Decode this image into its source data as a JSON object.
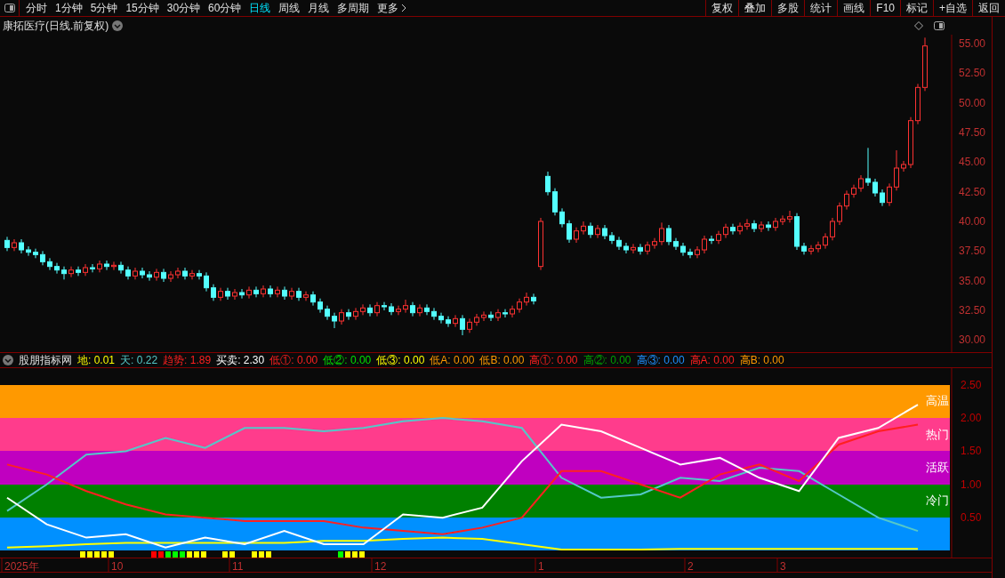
{
  "toolbar": {
    "periods": [
      {
        "label": "分时",
        "selected": false
      },
      {
        "label": "1分钟",
        "selected": false
      },
      {
        "label": "5分钟",
        "selected": false
      },
      {
        "label": "15分钟",
        "selected": false
      },
      {
        "label": "30分钟",
        "selected": false
      },
      {
        "label": "60分钟",
        "selected": false
      },
      {
        "label": "日线",
        "selected": true
      },
      {
        "label": "周线",
        "selected": false
      },
      {
        "label": "月线",
        "selected": false
      },
      {
        "label": "多周期",
        "selected": false
      },
      {
        "label": "更多",
        "selected": false,
        "kind": "menu"
      }
    ],
    "buttons": [
      "复权",
      "叠加",
      "多股",
      "统计",
      "画线",
      "F10",
      "标记",
      "+自选",
      "返回"
    ]
  },
  "price_chart": {
    "title": "康拓医疗(日线.前复权)",
    "chart_data": {
      "type": "candlestick",
      "ylim": [
        28.9,
        55.75
      ],
      "yticks": [
        {
          "value": 55,
          "label": "55.00"
        },
        {
          "value": 52.5,
          "label": "52.50"
        },
        {
          "value": 50,
          "label": "50.00"
        },
        {
          "value": 47.5,
          "label": "47.50"
        },
        {
          "value": 45,
          "label": "45.00"
        },
        {
          "value": 42.5,
          "label": "42.50"
        },
        {
          "value": 40,
          "label": "40.00"
        },
        {
          "value": 37.5,
          "label": "37.50"
        },
        {
          "value": 35,
          "label": "35.00"
        },
        {
          "value": 32.5,
          "label": "32.50"
        },
        {
          "value": 30,
          "label": "30.00"
        }
      ],
      "ohlc": [
        [
          38.4,
          38.7,
          37.5,
          37.8
        ],
        [
          37.8,
          38.5,
          37.5,
          38.2
        ],
        [
          38.2,
          38.5,
          37.3,
          37.6
        ],
        [
          37.6,
          37.9,
          37.1,
          37.4
        ],
        [
          37.4,
          37.7,
          36.9,
          37.2
        ],
        [
          37.2,
          37.5,
          36.3,
          36.6
        ],
        [
          36.6,
          36.9,
          35.9,
          36.2
        ],
        [
          36.2,
          36.5,
          35.6,
          35.9
        ],
        [
          35.9,
          36.2,
          35.1,
          35.6
        ],
        [
          35.6,
          36.2,
          35.3,
          35.9
        ],
        [
          35.9,
          36.2,
          35.4,
          35.7
        ],
        [
          35.7,
          36.4,
          35.4,
          36.1
        ],
        [
          36.1,
          36.4,
          35.7,
          36.0
        ],
        [
          36.0,
          36.7,
          35.7,
          36.4
        ],
        [
          36.4,
          36.7,
          35.9,
          36.2
        ],
        [
          36.2,
          36.6,
          35.9,
          36.3
        ],
        [
          36.3,
          36.6,
          35.6,
          35.9
        ],
        [
          35.9,
          36.2,
          35.1,
          35.4
        ],
        [
          35.4,
          36.1,
          35.1,
          35.8
        ],
        [
          35.8,
          36.1,
          35.2,
          35.5
        ],
        [
          35.5,
          35.8,
          35.0,
          35.3
        ],
        [
          35.3,
          36.0,
          35.0,
          35.7
        ],
        [
          35.7,
          36.0,
          34.9,
          35.2
        ],
        [
          35.2,
          35.8,
          34.9,
          35.5
        ],
        [
          35.5,
          36.1,
          35.2,
          35.8
        ],
        [
          35.8,
          36.1,
          35.1,
          35.4
        ],
        [
          35.4,
          35.9,
          35.1,
          35.6
        ],
        [
          35.6,
          35.9,
          35.1,
          35.4
        ],
        [
          35.4,
          35.7,
          34.1,
          34.4
        ],
        [
          34.4,
          34.7,
          33.3,
          33.6
        ],
        [
          33.6,
          34.4,
          33.3,
          34.1
        ],
        [
          34.1,
          34.4,
          33.4,
          33.7
        ],
        [
          33.7,
          34.3,
          33.4,
          34.0
        ],
        [
          34.0,
          34.3,
          33.5,
          33.8
        ],
        [
          33.8,
          34.5,
          33.5,
          34.2
        ],
        [
          34.2,
          34.5,
          33.6,
          33.9
        ],
        [
          33.9,
          34.6,
          33.6,
          34.3
        ],
        [
          34.3,
          34.6,
          33.6,
          33.9
        ],
        [
          33.9,
          34.5,
          33.6,
          34.2
        ],
        [
          34.2,
          34.5,
          33.4,
          33.7
        ],
        [
          33.7,
          34.4,
          33.4,
          34.1
        ],
        [
          34.1,
          34.4,
          33.3,
          33.6
        ],
        [
          33.6,
          34.1,
          33.3,
          33.8
        ],
        [
          33.8,
          34.1,
          32.9,
          33.2
        ],
        [
          33.2,
          33.5,
          32.3,
          32.6
        ],
        [
          32.6,
          32.9,
          31.7,
          32.0
        ],
        [
          32.0,
          32.3,
          31.0,
          31.6
        ],
        [
          31.6,
          32.6,
          31.3,
          32.3
        ],
        [
          32.3,
          32.6,
          31.7,
          32.0
        ],
        [
          32.0,
          32.7,
          31.7,
          32.4
        ],
        [
          32.4,
          33.0,
          32.1,
          32.7
        ],
        [
          32.7,
          33.0,
          32.0,
          32.3
        ],
        [
          32.3,
          33.2,
          32.0,
          32.9
        ],
        [
          32.9,
          33.2,
          32.5,
          32.8
        ],
        [
          32.8,
          33.1,
          32.1,
          32.4
        ],
        [
          32.4,
          32.9,
          32.1,
          32.6
        ],
        [
          32.6,
          33.4,
          32.3,
          32.9
        ],
        [
          32.9,
          33.2,
          32.0,
          32.3
        ],
        [
          32.3,
          33.0,
          32.0,
          32.7
        ],
        [
          32.7,
          33.0,
          32.1,
          32.4
        ],
        [
          32.4,
          32.7,
          31.7,
          32.0
        ],
        [
          32.0,
          32.3,
          31.4,
          31.7
        ],
        [
          31.7,
          32.0,
          31.1,
          31.4
        ],
        [
          31.4,
          32.1,
          31.1,
          31.8
        ],
        [
          31.8,
          32.1,
          30.4,
          30.9
        ],
        [
          30.9,
          31.8,
          30.6,
          31.5
        ],
        [
          31.5,
          32.2,
          31.2,
          31.9
        ],
        [
          31.9,
          32.4,
          31.6,
          32.1
        ],
        [
          32.1,
          32.4,
          31.6,
          31.9
        ],
        [
          31.9,
          32.6,
          31.6,
          32.3
        ],
        [
          32.3,
          32.6,
          31.9,
          32.2
        ],
        [
          32.2,
          32.9,
          31.9,
          32.6
        ],
        [
          32.6,
          33.5,
          32.3,
          33.2
        ],
        [
          33.2,
          34.0,
          32.9,
          33.6
        ],
        [
          33.6,
          33.9,
          33.0,
          33.3
        ],
        [
          36.2,
          40.3,
          35.9,
          40.0
        ],
        [
          43.8,
          44.2,
          42.2,
          42.5
        ],
        [
          42.5,
          42.8,
          40.5,
          40.8
        ],
        [
          40.8,
          41.1,
          39.5,
          39.8
        ],
        [
          39.8,
          40.1,
          38.2,
          38.5
        ],
        [
          38.5,
          39.5,
          38.2,
          39.2
        ],
        [
          39.2,
          40.0,
          38.9,
          39.6
        ],
        [
          39.6,
          39.9,
          38.6,
          38.9
        ],
        [
          38.9,
          39.7,
          38.6,
          39.4
        ],
        [
          39.4,
          39.7,
          38.5,
          38.8
        ],
        [
          38.8,
          39.1,
          38.1,
          38.4
        ],
        [
          38.4,
          38.7,
          37.6,
          37.9
        ],
        [
          37.9,
          38.2,
          37.3,
          37.6
        ],
        [
          37.6,
          38.1,
          37.3,
          37.8
        ],
        [
          37.8,
          38.1,
          37.2,
          37.5
        ],
        [
          37.5,
          38.3,
          37.2,
          38.0
        ],
        [
          38.0,
          38.6,
          37.7,
          38.3
        ],
        [
          38.3,
          39.9,
          38.0,
          39.4
        ],
        [
          39.4,
          39.7,
          38.0,
          38.3
        ],
        [
          38.3,
          38.6,
          37.6,
          37.9
        ],
        [
          37.9,
          38.2,
          37.1,
          37.4
        ],
        [
          37.4,
          37.7,
          36.9,
          37.2
        ],
        [
          37.2,
          37.9,
          36.9,
          37.6
        ],
        [
          37.6,
          38.8,
          37.3,
          38.5
        ],
        [
          38.5,
          38.8,
          38.1,
          38.4
        ],
        [
          38.4,
          39.2,
          38.1,
          38.9
        ],
        [
          38.9,
          39.8,
          38.6,
          39.5
        ],
        [
          39.5,
          39.8,
          38.9,
          39.2
        ],
        [
          39.2,
          39.9,
          38.9,
          39.6
        ],
        [
          39.6,
          40.2,
          39.3,
          39.8
        ],
        [
          39.8,
          40.1,
          39.1,
          39.4
        ],
        [
          39.4,
          40.0,
          39.1,
          39.7
        ],
        [
          39.7,
          40.0,
          39.2,
          39.5
        ],
        [
          39.5,
          40.3,
          39.2,
          40.0
        ],
        [
          40.0,
          40.5,
          39.7,
          40.2
        ],
        [
          40.2,
          40.9,
          39.9,
          40.4
        ],
        [
          40.4,
          40.7,
          37.6,
          37.9
        ],
        [
          37.9,
          38.2,
          37.2,
          37.5
        ],
        [
          37.5,
          38.0,
          37.2,
          37.7
        ],
        [
          37.7,
          38.3,
          37.4,
          38.0
        ],
        [
          38.0,
          39.0,
          37.7,
          38.7
        ],
        [
          38.7,
          40.3,
          38.4,
          40.0
        ],
        [
          40.0,
          41.6,
          39.7,
          41.3
        ],
        [
          41.3,
          42.6,
          41.0,
          42.3
        ],
        [
          42.3,
          43.1,
          42.0,
          42.8
        ],
        [
          42.8,
          43.9,
          42.5,
          43.6
        ],
        [
          43.6,
          46.2,
          43.0,
          43.3
        ],
        [
          43.3,
          43.6,
          42.1,
          42.4
        ],
        [
          42.4,
          42.7,
          41.3,
          41.6
        ],
        [
          41.6,
          43.2,
          41.3,
          42.9
        ],
        [
          42.9,
          46.0,
          42.6,
          44.5
        ],
        [
          44.5,
          45.1,
          44.2,
          44.8
        ],
        [
          44.8,
          48.8,
          44.5,
          48.5
        ],
        [
          48.5,
          51.6,
          48.2,
          51.3
        ],
        [
          51.3,
          55.5,
          51.0,
          54.8
        ]
      ]
    }
  },
  "indicator": {
    "name": "股朋指标网",
    "bands": [
      {
        "label": "高温",
        "color": "#ff9900"
      },
      {
        "label": "热门",
        "color": "#ff3c8c"
      },
      {
        "label": "活跃",
        "color": "#c000c0"
      },
      {
        "label": "冷门",
        "color": "#008000"
      },
      {
        "color": "#0090ff"
      }
    ],
    "separator": ":",
    "series_readings": [
      "0.01",
      "0.22",
      "1.89",
      "2.30"
    ],
    "legend": [
      {
        "label": "低①",
        "value": "0.00",
        "color": "#ff2020"
      },
      {
        "label": "低②",
        "value": "0.00",
        "color": "#00e000"
      },
      {
        "label": "低③",
        "value": "0.00",
        "color": "#ffff00"
      },
      {
        "label": "低A",
        "value": "0.00",
        "color": "#ff9900"
      },
      {
        "label": "低B",
        "value": "0.00",
        "color": "#ff9900"
      },
      {
        "label": "高①",
        "value": "0.00",
        "color": "#ff2020"
      },
      {
        "label": "高②",
        "value": "0.00",
        "color": "#00a000"
      },
      {
        "label": "高③",
        "value": "0.00",
        "color": "#1e90ff"
      },
      {
        "label": "高A",
        "value": "0.00",
        "color": "#ff2020"
      },
      {
        "label": "高B",
        "value": "0.00",
        "color": "#ff9900"
      }
    ],
    "signals": [
      {
        "color": "#ffff00"
      },
      {
        "color": "#ffff00"
      },
      {
        "color": "#ffff00"
      },
      {
        "color": "#ffff00"
      },
      {
        "color": "#ffff00"
      },
      {
        "color": "#ff0000"
      },
      {
        "color": "#ff0000"
      },
      {
        "color": "#00ff00"
      },
      {
        "color": "#00ff00"
      },
      {
        "color": "#00ff00"
      },
      {
        "color": "#ffff00"
      },
      {
        "color": "#ffff00"
      },
      {
        "color": "#ffff00"
      },
      {
        "color": "#ffff00"
      },
      {
        "color": "#ffff00"
      },
      {
        "color": "#ffff00"
      },
      {
        "color": "#ffff00"
      },
      {
        "color": "#ffff00"
      },
      {
        "color": "#00ff00"
      },
      {
        "color": "#ffff00"
      },
      {
        "color": "#ffff00"
      },
      {
        "color": "#ffff00"
      }
    ],
    "chart_data": {
      "type": "line",
      "ylim": [
        -0.1,
        2.75
      ],
      "yticks": [
        {
          "value": 0.5,
          "label": "0.50"
        },
        {
          "value": 1,
          "label": "1.00"
        },
        {
          "value": 1.5,
          "label": "1.50"
        },
        {
          "value": 2,
          "label": "2.00"
        },
        {
          "value": 2.5,
          "label": "2.50"
        }
      ],
      "series": [
        {
          "name": "地",
          "color": "#ffff00",
          "values": [
            0.05,
            0.07,
            0.1,
            0.12,
            0.12,
            0.12,
            0.12,
            0.12,
            0.15,
            0.15,
            0.18,
            0.2,
            0.18,
            0.1,
            0.02,
            0.02,
            0.02,
            0.03,
            0.03,
            0.03,
            0.03,
            0.03,
            0.03,
            0.03
          ]
        },
        {
          "name": "天",
          "color": "#54c8c8",
          "values": [
            0.6,
            1.0,
            1.45,
            1.5,
            1.7,
            1.55,
            1.85,
            1.85,
            1.8,
            1.85,
            1.95,
            2.0,
            1.95,
            1.85,
            1.1,
            0.8,
            0.85,
            1.1,
            1.05,
            1.25,
            1.2,
            0.85,
            0.5,
            0.3
          ]
        },
        {
          "name": "趋势",
          "color": "#ff2020",
          "values": [
            1.3,
            1.15,
            0.9,
            0.7,
            0.55,
            0.5,
            0.45,
            0.45,
            0.45,
            0.35,
            0.3,
            0.25,
            0.35,
            0.5,
            1.2,
            1.2,
            1.0,
            0.8,
            1.15,
            1.3,
            1.05,
            1.6,
            1.8,
            1.9
          ]
        },
        {
          "name": "买卖",
          "color": "#ffffff",
          "values": [
            0.8,
            0.4,
            0.2,
            0.25,
            0.05,
            0.2,
            0.1,
            0.3,
            0.1,
            0.1,
            0.55,
            0.5,
            0.65,
            1.35,
            1.9,
            1.8,
            1.55,
            1.3,
            1.4,
            1.1,
            0.9,
            1.7,
            1.85,
            2.2
          ]
        }
      ]
    }
  },
  "date_axis": [
    "2025年",
    "10",
    "11",
    "12",
    "1",
    "2",
    "3"
  ]
}
